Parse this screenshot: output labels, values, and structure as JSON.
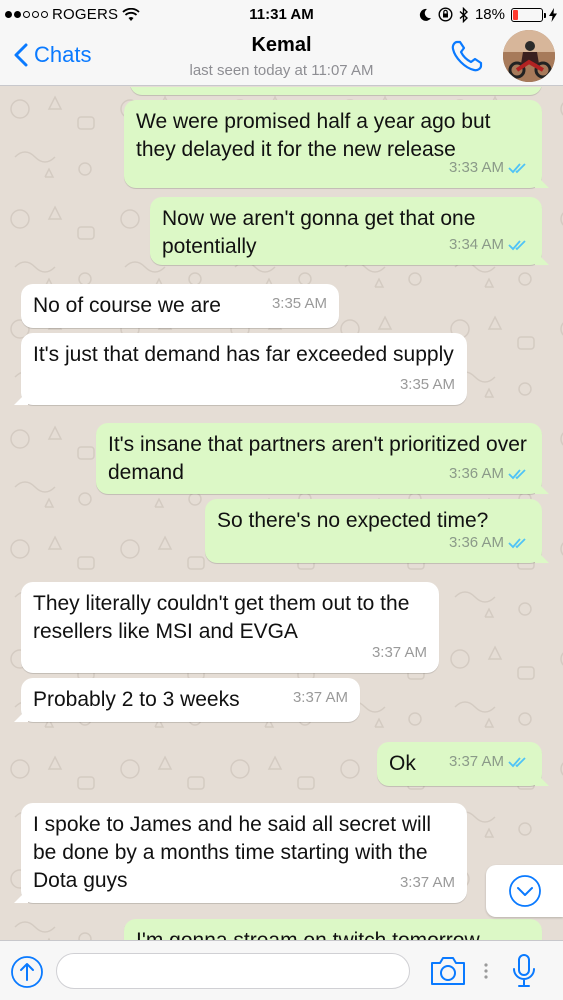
{
  "status_bar": {
    "carrier": "ROGERS",
    "time": "11:31 AM",
    "battery": "18%",
    "battery_level": 0.18
  },
  "header": {
    "back_label": "Chats",
    "contact_name": "Kemal",
    "last_seen": "last seen today at 11:07 AM",
    "icons": [
      "chevron-left-icon",
      "phone-icon",
      "avatar"
    ]
  },
  "messages": [
    {
      "dir": "out",
      "text": "We were promised half a year ago but they delayed it for the new release",
      "time": "3:33 AM",
      "read": true
    },
    {
      "dir": "out",
      "text": "Now we aren't gonna get that one potentially",
      "time": "3:34 AM",
      "read": true
    },
    {
      "dir": "in",
      "text": "No of course we are",
      "time": "3:35 AM"
    },
    {
      "dir": "in",
      "text": "It's just that demand has far exceeded supply",
      "time": "3:35 AM"
    },
    {
      "dir": "out",
      "text": "It's insane that partners aren't prioritized over demand",
      "time": "3:36 AM",
      "read": true
    },
    {
      "dir": "out",
      "text": "So there's no expected time?",
      "time": "3:36 AM",
      "read": true
    },
    {
      "dir": "in",
      "text": "They literally couldn't get them out to the resellers like MSI and EVGA",
      "time": "3:37 AM"
    },
    {
      "dir": "in",
      "text": "Probably 2 to 3 weeks",
      "time": "3:37 AM"
    },
    {
      "dir": "out",
      "text": "Ok",
      "time": "3:37 AM",
      "read": true
    },
    {
      "dir": "in",
      "text": "I spoke to James and he said all secret will be done by a months time starting with the Dota guys",
      "time": "3:37 AM"
    },
    {
      "dir": "out",
      "text": "I'm gonna stream on twitch tomorrow",
      "time": "",
      "read": false
    }
  ],
  "input": {
    "value": "",
    "icons": [
      "upload-icon",
      "camera-icon",
      "microphone-icon"
    ]
  },
  "colors": {
    "accent": "#0a7aff",
    "outgoing_bubble": "#dcf8c6",
    "incoming_bubble": "#ffffff",
    "chat_background": "#e5ddd5",
    "read_ticks": "#4fc3f7",
    "battery_low": "#ff3b30"
  }
}
